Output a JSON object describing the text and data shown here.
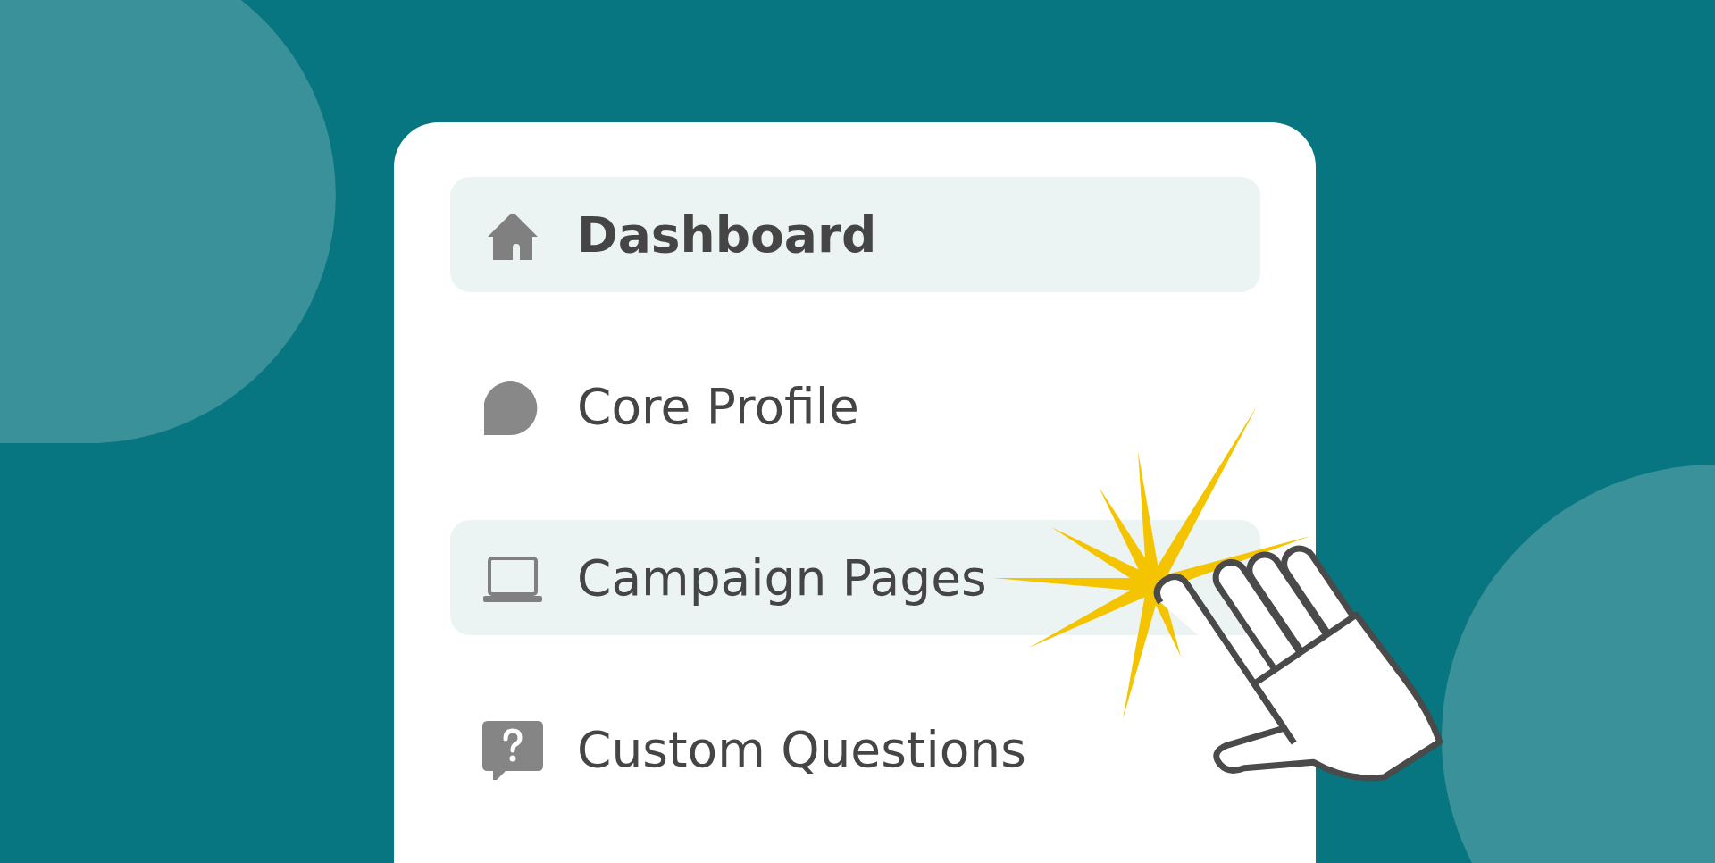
{
  "menu": {
    "items": [
      {
        "kind": "home",
        "label": "Dashboard",
        "selected": true,
        "hovered": false
      },
      {
        "kind": "profile",
        "label": "Core Profile",
        "selected": false,
        "hovered": false
      },
      {
        "kind": "laptop",
        "label": "Campaign Pages",
        "selected": false,
        "hovered": true
      },
      {
        "kind": "question",
        "label": "Custom Questions",
        "selected": false,
        "hovered": false
      }
    ]
  }
}
